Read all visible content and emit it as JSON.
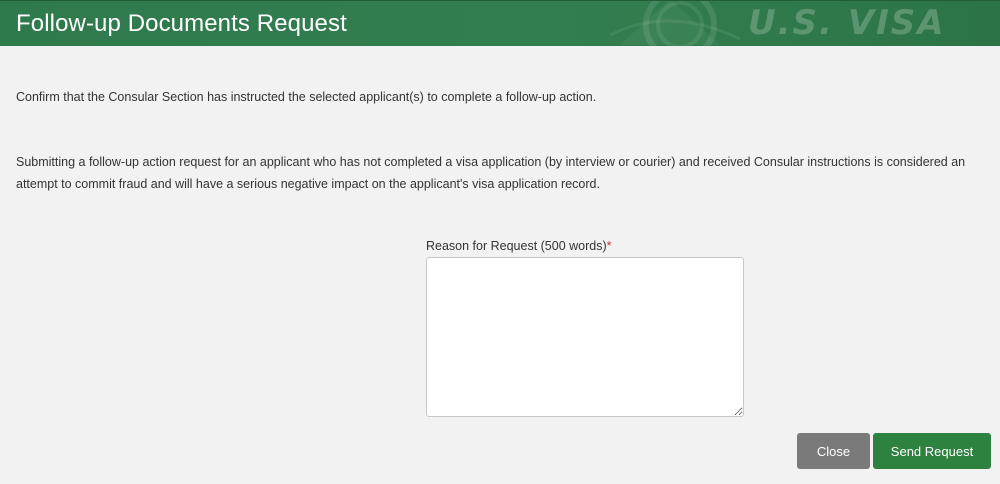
{
  "header": {
    "title": "Follow-up Documents Request",
    "watermark_text": "U.S. VISA",
    "background_color": "#2f7a4c"
  },
  "content": {
    "confirm_text": "Confirm that the Consular Section has instructed the selected applicant(s) to complete a follow-up action.",
    "warning_text": "Submitting a follow-up action request for an applicant who has not completed a visa application (by interview or courier) and received Consular instructions is considered an attempt to commit fraud and will have a serious negative impact on the applicant's visa application record."
  },
  "form": {
    "reason_label": "Reason for Request (500 words)",
    "required_marker": "*",
    "reason_value": "",
    "reason_placeholder": ""
  },
  "buttons": {
    "close_label": "Close",
    "send_label": "Send Request",
    "close_color": "#7a7a7a",
    "send_color": "#2e8240"
  }
}
